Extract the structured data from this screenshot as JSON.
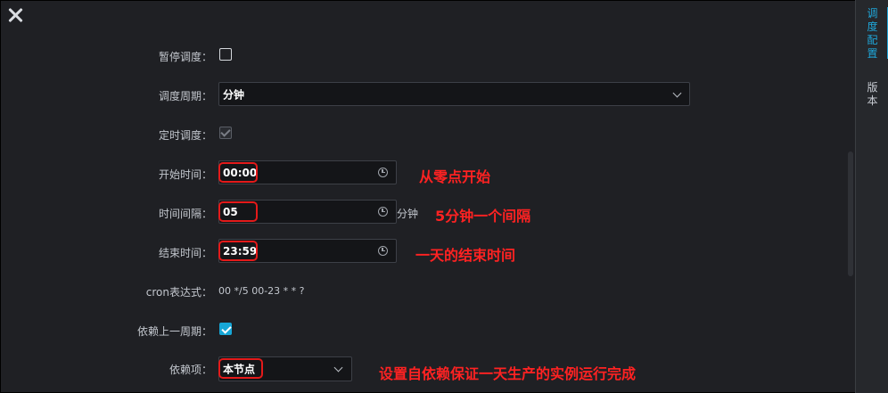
{
  "form": {
    "pause": {
      "label": "暂停调度：",
      "checked": false
    },
    "cycle": {
      "label": "调度周期：",
      "value": "分钟"
    },
    "timed": {
      "label": "定时调度：",
      "checked": true,
      "disabled": true
    },
    "start": {
      "label": "开始时间：",
      "value": "00:00"
    },
    "interval": {
      "label": "时间间隔：",
      "value": "05",
      "unit": "分钟"
    },
    "end": {
      "label": "结束时间：",
      "value": "23:59"
    },
    "cron": {
      "label": "cron表达式：",
      "value": "00 */5 00-23 * * ?"
    },
    "depend_prev": {
      "label": "依赖上一周期：",
      "checked": true
    },
    "depend_item": {
      "label": "依赖项：",
      "value": "本节点"
    }
  },
  "annotations": {
    "start": "从零点开始",
    "interval": "5分钟一个间隔",
    "end": "一天的结束时间",
    "depend": "设置自依赖保证一天生产的实例运行完成"
  },
  "right_panel": {
    "tabs": [
      {
        "label_chars": [
          "调",
          "度",
          "配",
          "置"
        ],
        "active": true
      },
      {
        "label_chars": [
          "版",
          "本"
        ],
        "active": false
      }
    ]
  },
  "colors": {
    "accent": "#1fa6d9",
    "annotation": "#ff2222",
    "background": "#1f2024"
  }
}
